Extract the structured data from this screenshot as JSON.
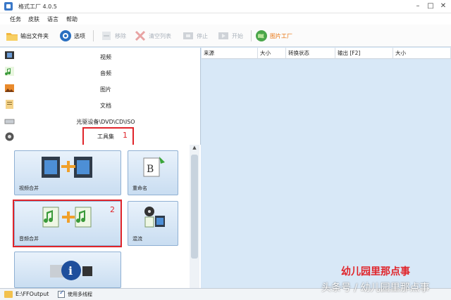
{
  "window": {
    "title": "格式工厂 4.0.5"
  },
  "menu": [
    "任务",
    "皮肤",
    "语言",
    "帮助"
  ],
  "toolbar": {
    "output_folder": "输出文件夹",
    "options": "选项",
    "remove": "移除",
    "clear_list": "清空列表",
    "stop": "停止",
    "start": "开始",
    "picture_factory": "图片工厂"
  },
  "categories": [
    "视频",
    "音频",
    "图片",
    "文档",
    "光驱设备\\DVD\\CD\\ISO",
    "工具集"
  ],
  "annotations": {
    "one": "1",
    "two": "2"
  },
  "tiles": {
    "video_merge": "视频合并",
    "rename": "重命名",
    "audio_merge": "音频合并",
    "mix": "混流"
  },
  "columns": [
    "来源",
    "大小",
    "转换状态",
    "输出 [F2]",
    "大小"
  ],
  "status": {
    "path": "E:\\FFOutput",
    "multithread": "使用多线程"
  },
  "overlay": {
    "brand_red": "幼儿园里那点事",
    "watermark": "头条号 / 幼儿园里那点事"
  },
  "colors": {
    "accent": "#2a6fc0",
    "annotation": "#e0242a",
    "highlight": "#e8720c"
  }
}
